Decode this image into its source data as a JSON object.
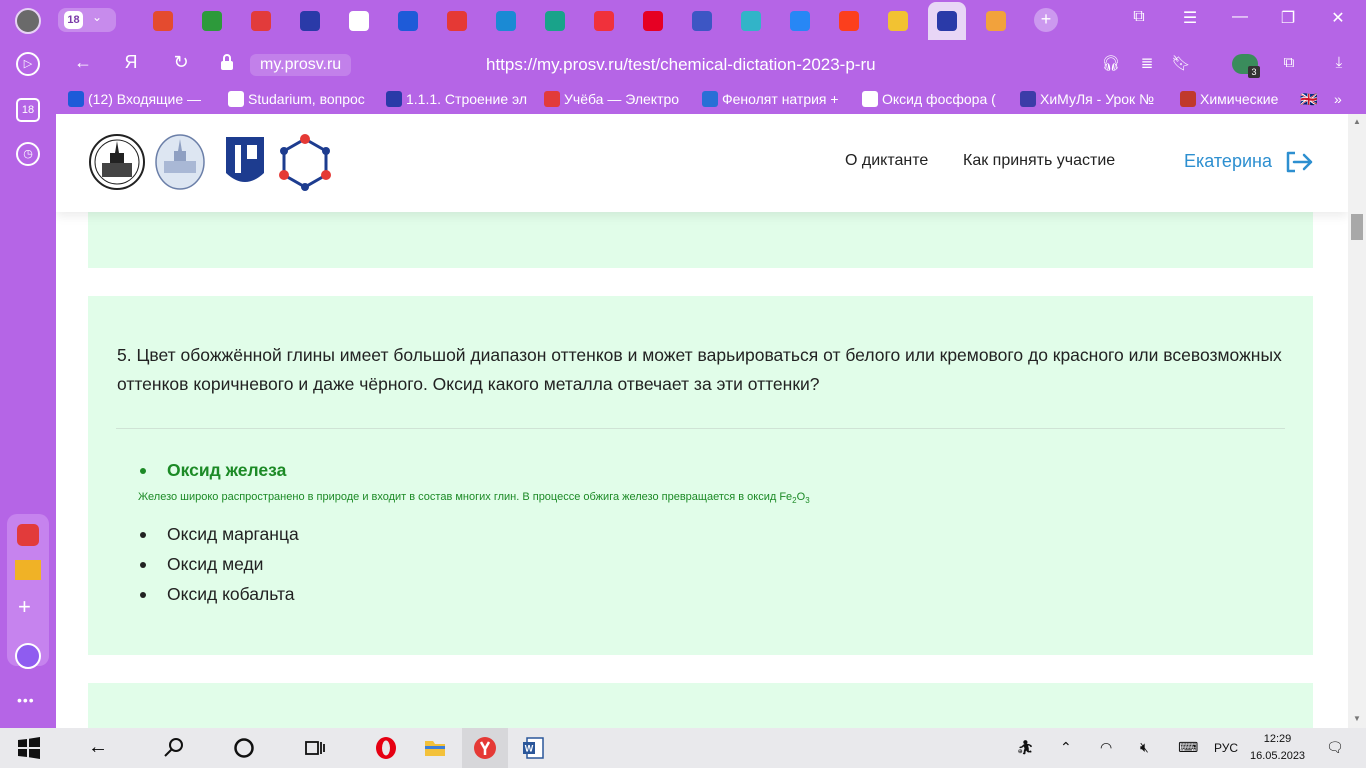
{
  "browser": {
    "tab_count": "18",
    "domain": "my.prosv.ru",
    "url": "https://my.prosv.ru/test/chemical-dictation-2023-p-ru",
    "extension_badge": "3",
    "tabs": [
      {
        "icon": "microsoft-icon",
        "color": "#e44b2f"
      },
      {
        "icon": "microsoft-icon",
        "color": "#2d9a3b"
      },
      {
        "icon": "document-icon",
        "color": "#e23b3b"
      },
      {
        "icon": "shield-icon",
        "color": "#2a3aa8"
      },
      {
        "icon": "app-icon",
        "color": "#ffffff"
      },
      {
        "icon": "swoosh-icon",
        "color": "#1e5bd8"
      },
      {
        "icon": "letter-n-icon",
        "color": "#e53935"
      },
      {
        "icon": "globe-icon",
        "color": "#1b8ad4"
      },
      {
        "icon": "book-icon",
        "color": "#19a38a"
      },
      {
        "icon": "play-icon",
        "color": "#f0313b"
      },
      {
        "icon": "pinterest-icon",
        "color": "#e60023"
      },
      {
        "icon": "pencil-icon",
        "color": "#3d56c4"
      },
      {
        "icon": "circle-icon",
        "color": "#32b4c8"
      },
      {
        "icon": "vk-icon",
        "color": "#2787f5"
      },
      {
        "icon": "yandex-icon",
        "color": "#fc3f1d"
      },
      {
        "icon": "lit-icon",
        "color": "#f2c232"
      },
      {
        "icon": "shield-icon",
        "color": "#2a3aa8"
      },
      {
        "icon": "paper-plane-icon",
        "color": "#f2a23c"
      }
    ],
    "bookmarks": [
      {
        "label": "(12) Входящие — ",
        "color": "#1e5bd8"
      },
      {
        "label": "Studarium, вопрос",
        "color": "#ffffff"
      },
      {
        "label": "1.1.1. Строение эл",
        "color": "#2a3aa8"
      },
      {
        "label": "Учёба — Электро",
        "color": "#e23b3b"
      },
      {
        "label": "Фенолят натрия +",
        "color": "#2a6fd6"
      },
      {
        "label": "Оксид фосфора (",
        "color": "#ffffff"
      },
      {
        "label": "ХиМуЛя - Урок №",
        "color": "#3c3ca8"
      },
      {
        "label": "Химические",
        "color": "#c0392b"
      }
    ]
  },
  "header": {
    "nav": [
      "О диктанте",
      "Как принять участие"
    ],
    "user_name": "Екатерина"
  },
  "question": {
    "text": "5. Цвет обожжённой глины имеет большой диапазон оттенков и может варьироваться от белого или кремового до красного или всевозможных оттенков коричневого и даже чёрного. Оксид какого металла отвечает за эти оттенки?",
    "correct_option": "Оксид железа",
    "explanation_prefix": "Железо широко распространено в природе и входит в состав многих глин. В процессе обжига железо превращается в оксид Fe",
    "explanation_sub1": "2",
    "explanation_mid": "O",
    "explanation_sub2": "3",
    "other_options": [
      "Оксид марганца",
      "Оксид меди",
      "Оксид кобальта"
    ]
  },
  "taskbar": {
    "language": "РУС",
    "time": "12:29",
    "date": "16.05.2023"
  },
  "theme": {
    "chrome": "#b565e6",
    "card_bg": "#e1fde9",
    "correct": "#1c8a26",
    "link": "#2d8fd0"
  }
}
